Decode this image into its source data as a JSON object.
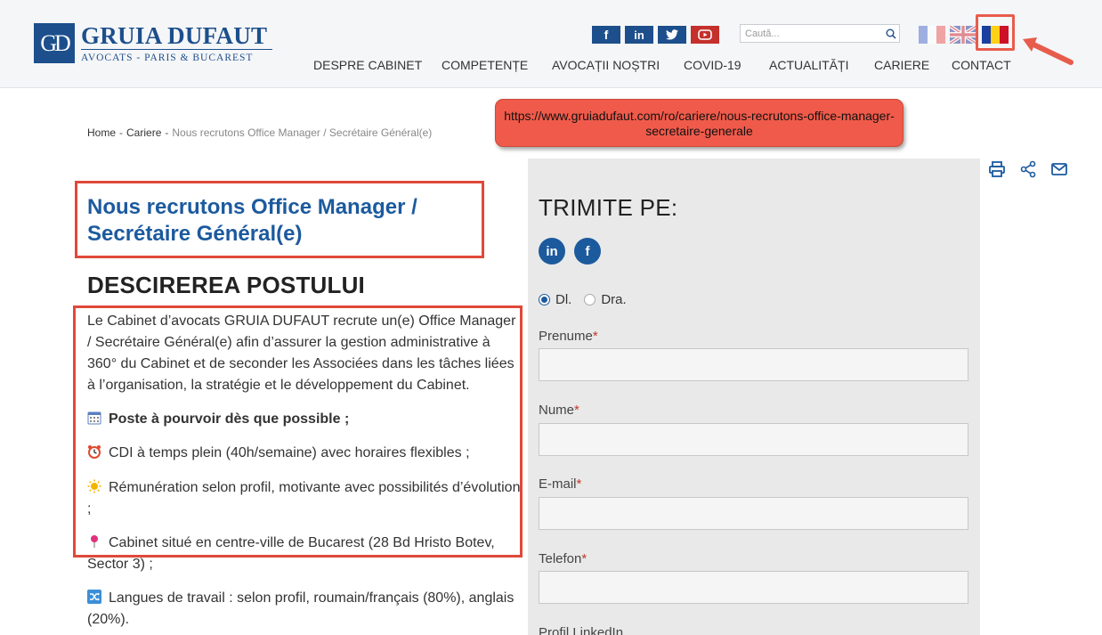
{
  "header": {
    "logo": {
      "mark": "GD",
      "name": "GRUIA DUFAUT",
      "subtitle": "AVOCATS - PARIS & BUCAREST"
    },
    "social": [
      {
        "name": "facebook-icon",
        "glyph": "f"
      },
      {
        "name": "linkedin-icon",
        "glyph": "in"
      },
      {
        "name": "twitter-icon",
        "glyph": "t"
      },
      {
        "name": "youtube-icon",
        "glyph": "▶"
      }
    ],
    "search": {
      "placeholder": "Caută..."
    },
    "languages": [
      "fr",
      "en",
      "ro"
    ],
    "nav": [
      "DESPRE CABINET",
      "COMPETENȚE",
      "AVOCAȚII NOȘTRI",
      "COVID-19",
      "ACTUALITĂȚI",
      "CARIERE",
      "CONTACT"
    ]
  },
  "breadcrumb": {
    "home": "Home",
    "section": "Cariere",
    "current": "Nous recrutons Office Manager / Secrétaire Général(e)",
    "separator": "-"
  },
  "annotation": {
    "url": "https://www.gruiadufaut.com/ro/cariere/nous-recrutons-office-manager-secretaire-generale"
  },
  "main": {
    "title": "Nous recrutons Office Manager / Secrétaire Général(e)",
    "section_heading": "DESCIREREA POSTULUI",
    "intro": "Le Cabinet d’avocats GRUIA DUFAUT recrute un(e) Office Manager / Secrétaire Général(e) afin d’assurer la gestion administrative à 360° du Cabinet et de seconder les Associées dans les tâches liées à l’organisation, la stratégie et le développement du Cabinet.",
    "bullets": [
      {
        "icon": "calendar-icon",
        "text": "Poste à pourvoir dès que possible ;",
        "bold": true
      },
      {
        "icon": "alarm-clock-icon",
        "text": "CDI à temps plein (40h/semaine) avec horaires flexibles ;"
      },
      {
        "icon": "sun-icon",
        "text": "Rémunération selon profil, motivante avec possibilités d’évolution ;"
      },
      {
        "icon": "pin-icon",
        "text": "Cabinet situé en centre-ville de Bucarest (28 Bd Hristo Botev, Sector 3) ;"
      },
      {
        "icon": "shuffle-icon",
        "text": "Langues de travail : selon profil, roumain/français (80%), anglais (20%)."
      }
    ]
  },
  "form": {
    "title": "TRIMITE PE:",
    "share": [
      "in",
      "f"
    ],
    "salutation": {
      "options": [
        "Dl.",
        "Dra."
      ],
      "selected": "Dl."
    },
    "fields": [
      {
        "label": "Prenume",
        "required": "*"
      },
      {
        "label": "Nume",
        "required": "*"
      },
      {
        "label": "E-mail",
        "required": "*"
      },
      {
        "label": "Telefon",
        "required": "*"
      },
      {
        "label": "Profil LinkedIn",
        "required": ""
      }
    ]
  },
  "colors": {
    "brand_blue": "#1c4f8c",
    "link_blue": "#1c5a9e",
    "annotation_red": "#e0493a",
    "panel_grey": "#e9e9e9"
  }
}
